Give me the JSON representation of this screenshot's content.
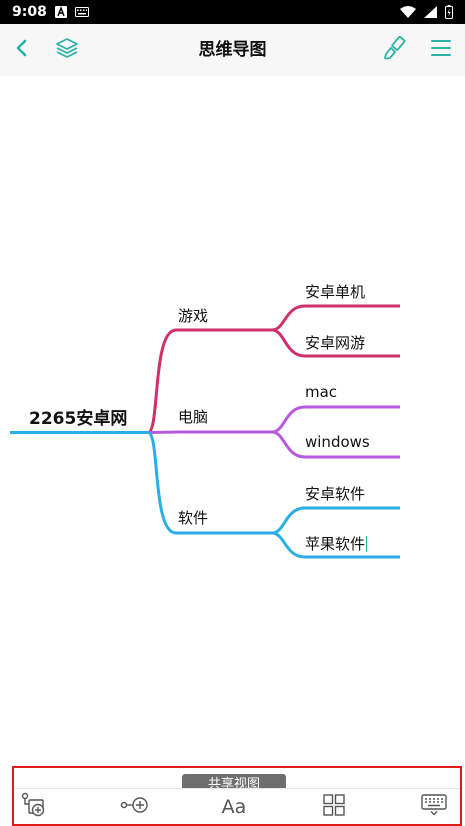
{
  "status_bar": {
    "time": "9:08",
    "icons": [
      "notification-a-icon",
      "keyboard-icon",
      "wifi-icon",
      "signal-icon",
      "battery-icon"
    ]
  },
  "app_bar": {
    "title": "思维导图",
    "left_icons": [
      "back-icon",
      "layers-icon"
    ],
    "right_icons": [
      "brush-icon",
      "menu-icon"
    ],
    "accent_color": "#2ab3a6"
  },
  "mindmap": {
    "root": {
      "label": "2265安卓网",
      "color": "#29aee6"
    },
    "branches": [
      {
        "label": "游戏",
        "color": "#d0306a",
        "children": [
          "安卓单机",
          "安卓网游"
        ]
      },
      {
        "label": "电脑",
        "color": "#b85ae0",
        "children": [
          "mac",
          "windows"
        ]
      },
      {
        "label": "软件",
        "color": "#29aee6",
        "children": [
          "安卓软件",
          "苹果软件"
        ]
      }
    ]
  },
  "toolbar": {
    "tooltip": "共享视图",
    "tools": [
      "add-sibling-node-icon",
      "add-child-node-icon",
      "text-style-icon",
      "layout-grid-icon",
      "keyboard-hide-icon"
    ],
    "text_style_label": "Aa",
    "highlight_color": "#e01b1b"
  }
}
